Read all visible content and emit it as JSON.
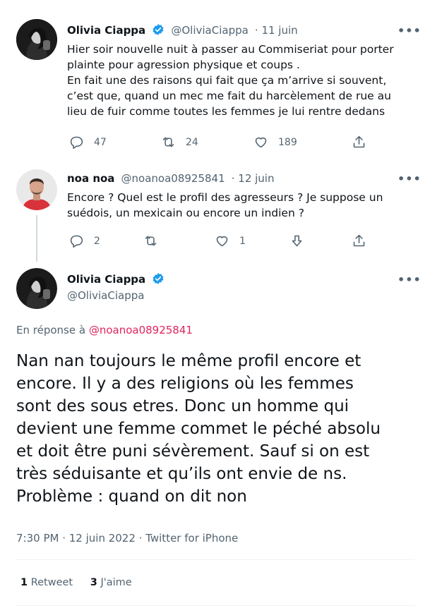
{
  "tweet1": {
    "name": "Olivia Ciappa",
    "handle": "@OliviaCiappa",
    "date": "· 11 juin",
    "lines": [
      "Hier soir nouvelle nuit à passer au Commiseriat pour porter",
      "plainte pour agression physique et coups .",
      "En fait une des raisons qui fait que ça m’arrive si souvent,",
      "c’est que, quand un mec me fait du harcèlement de rue au",
      "lieu de fuir comme toutes les femmes je lui rentre dedans"
    ],
    "replies": "47",
    "retweets": "24",
    "likes": "189"
  },
  "tweet2": {
    "name": "noa noa",
    "handle": "@noanoa08925841",
    "date": "· 12 juin",
    "lines": [
      "Encore ? Quel est le profil des agresseurs ? Je suppose un",
      "suédois, un mexicain ou encore un indien ?"
    ],
    "replies": "2",
    "likes": "1"
  },
  "main_tweet": {
    "name": "Olivia Ciappa",
    "handle": "@OliviaCiappa",
    "reply_prefix": "En réponse à",
    "reply_to": "@noanoa08925841",
    "lines": [
      "Nan nan toujours le même profil encore et",
      "encore. Il y a des religions où les femmes",
      "sont des sous etres. Donc un homme qui",
      "devient une femme commet le péché absolu",
      "et doit être puni sévèrement. Sauf si on est",
      "très séduisante et qu’ils ont envie de ns.",
      "Problème : quand on dit non"
    ],
    "timestamp": "7:30 PM · 12 juin 2022 · Twitter for iPhone",
    "retweet_count": "1",
    "retweet_label": "Retweet",
    "like_count": "3",
    "like_label": "J'aime"
  },
  "colors": {
    "verified": "#1d9bf0",
    "link": "#e0245e",
    "secondary": "#536471"
  },
  "more_label": "•••"
}
